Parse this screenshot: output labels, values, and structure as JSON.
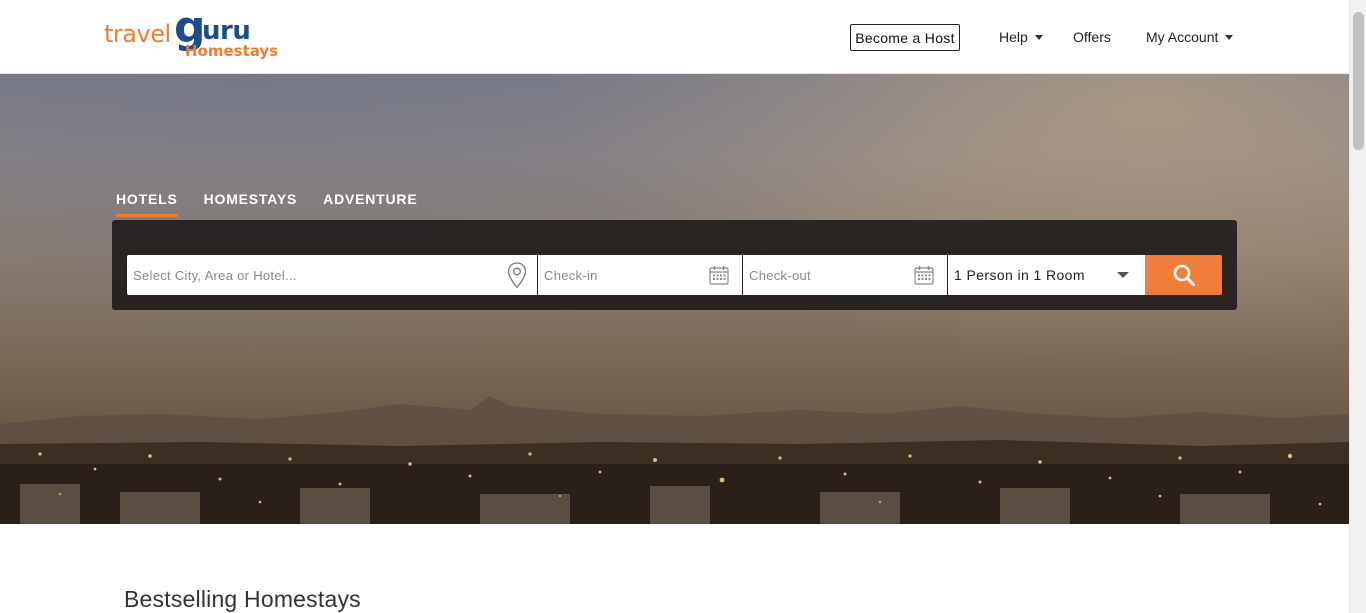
{
  "header": {
    "logo": {
      "travel": "travel",
      "g": "g",
      "uru": "uru",
      "homestays": "Homestays"
    },
    "become_host": "Become a Host",
    "help": "Help",
    "offers": "Offers",
    "my_account": "My Account"
  },
  "hero": {
    "tabs": [
      {
        "label": "HOTELS",
        "active": true
      },
      {
        "label": "HOMESTAYS",
        "active": false
      },
      {
        "label": "ADVENTURE",
        "active": false
      }
    ],
    "search": {
      "city_placeholder": "Select City, Area or Hotel...",
      "checkin_placeholder": "Check-in",
      "checkout_placeholder": "Check-out",
      "guests_value": "1 Person in 1 Room"
    }
  },
  "section": {
    "title": "Bestselling Homestays"
  },
  "colors": {
    "accent": "#f07d2f",
    "brand_blue": "#1d4d8a",
    "panel": "#1e1b1a"
  },
  "icons": [
    "location-pin-icon",
    "calendar-icon",
    "dropdown-arrow-icon",
    "search-icon",
    "caret-down-icon"
  ]
}
